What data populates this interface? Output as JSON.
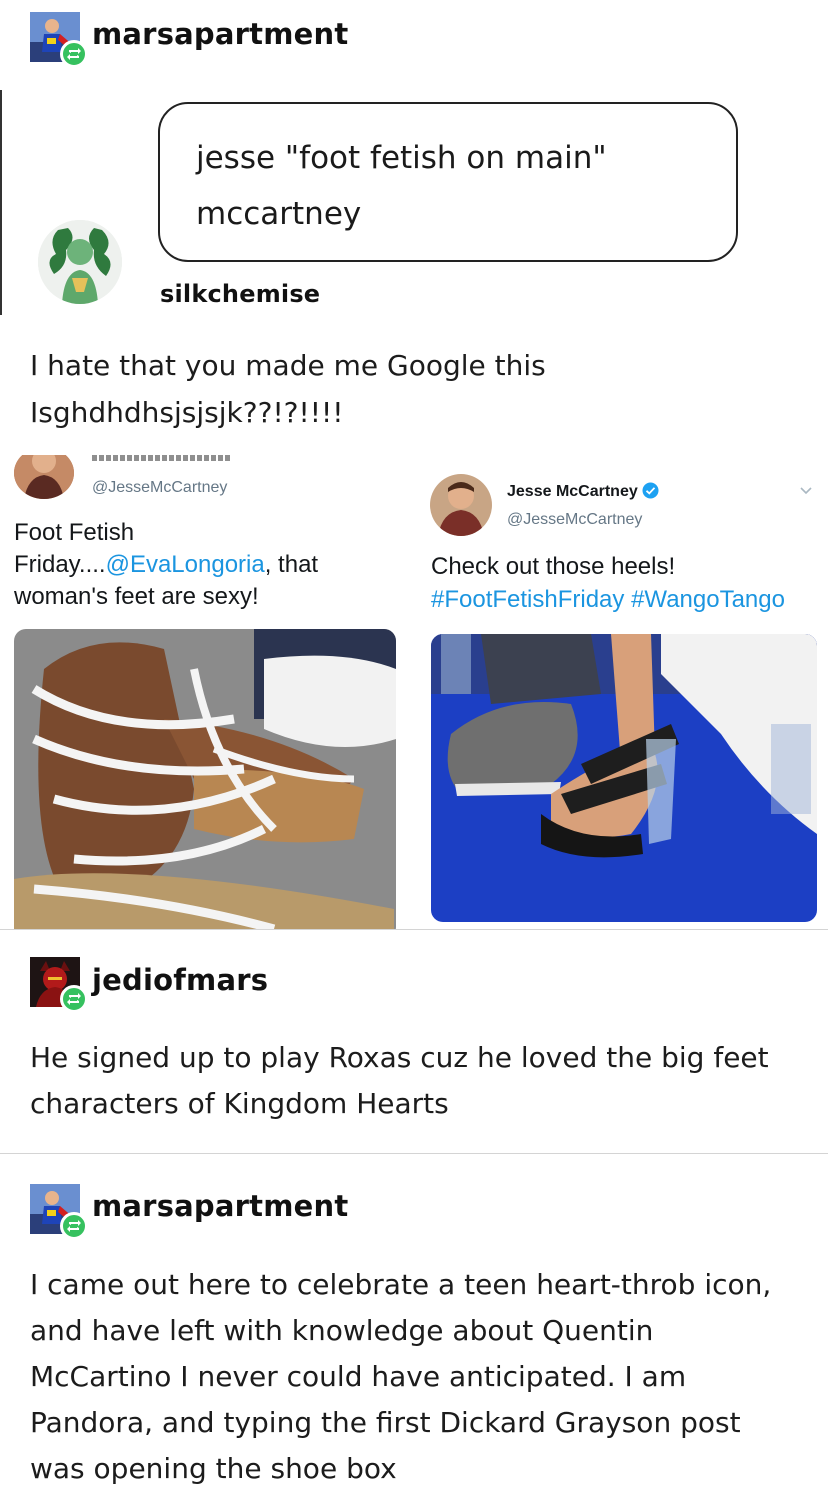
{
  "post1": {
    "username": "marsapartment",
    "quote": {
      "line1": "jesse \"foot fetish on main\"",
      "line2": "mccartney",
      "author": "silkchemise"
    },
    "text_line1": "I hate that you made me Google this",
    "text_line2": "Isghdhdhsjsjsjk??!?!!!!"
  },
  "tweet_left": {
    "handle": "@JesseMcCartney",
    "text_line1": "Foot Fetish",
    "text_prefix": "Friday....",
    "mention": "@EvaLongoria",
    "text_suffix": ", that",
    "text_line3": "woman's feet are sexy!"
  },
  "tweet_right": {
    "name": "Jesse McCartney",
    "handle": "@JesseMcCartney",
    "text_line1": "Check out those heels!",
    "hashtag1": "#FootFetishFriday",
    "hashtag2": "#WangoTango"
  },
  "post2": {
    "username": "jediofmars",
    "text_line1": "He signed up to play Roxas cuz he loved the big feet",
    "text_line2": "characters of Kingdom Hearts"
  },
  "post3": {
    "username": "marsapartment",
    "lines": [
      "I came out here to celebrate a teen heart-throb icon,",
      "and have left with knowledge about Quentin",
      "McCartino I never could have anticipated. I am",
      "Pandora, and typing the first Dickard Grayson post",
      "was opening the shoe box"
    ]
  },
  "colors": {
    "reblog_green": "#36c15f",
    "twitter_link": "#1b95e0",
    "verified_blue": "#1da1f2",
    "carpet_blue": "#1c3fc4"
  }
}
